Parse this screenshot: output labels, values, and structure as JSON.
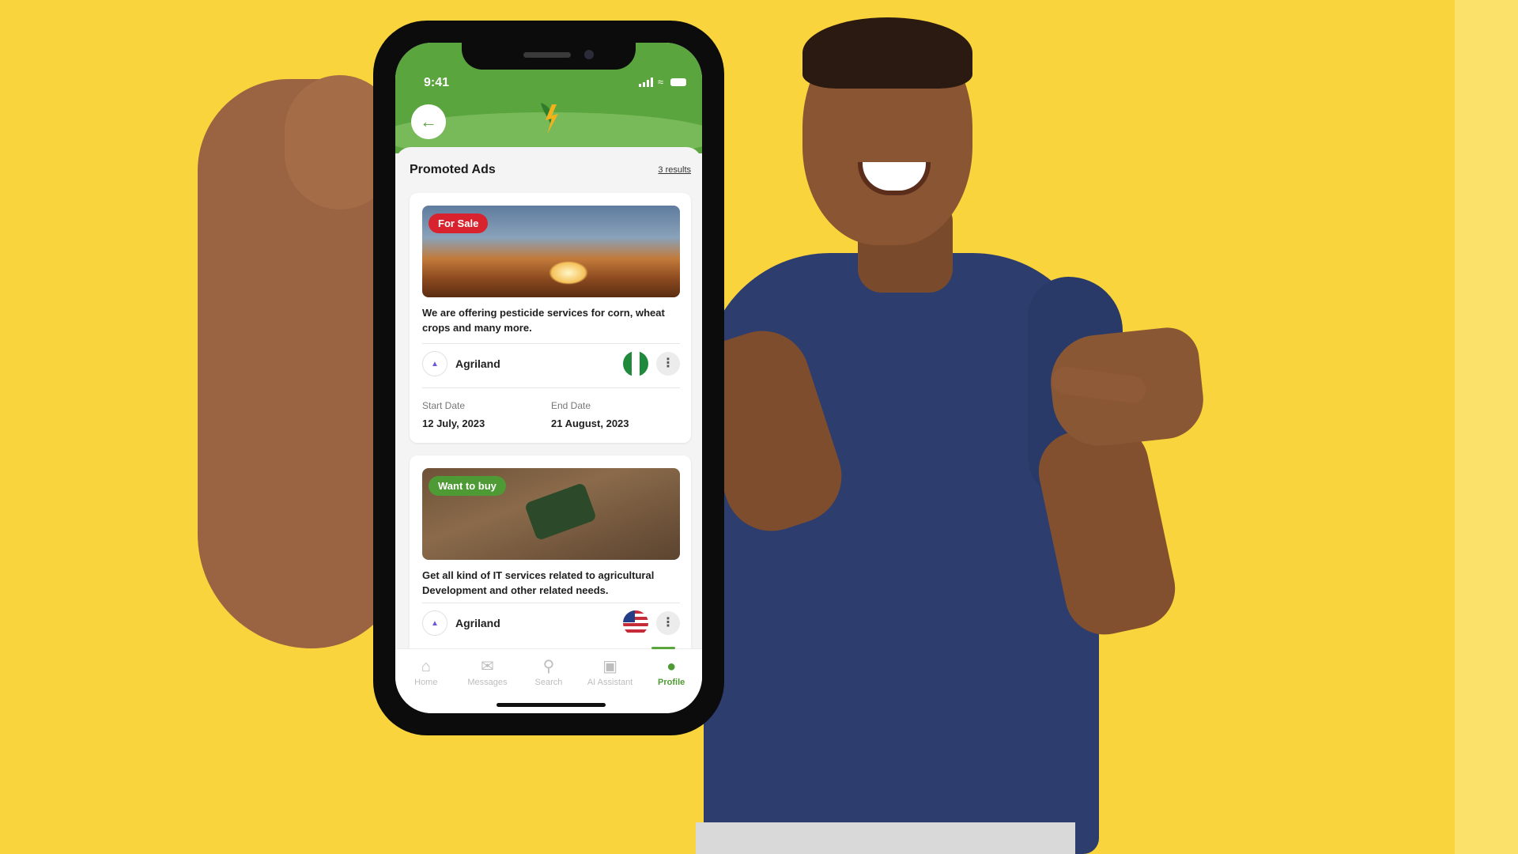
{
  "status_bar": {
    "time": "9:41"
  },
  "header": {
    "back_icon": "arrow-left-icon",
    "logo_icon": "app-leaf-logo"
  },
  "list": {
    "title": "Promoted Ads",
    "count": "3 results"
  },
  "ads": [
    {
      "badge": "For Sale",
      "badge_color": "#d8232f",
      "description": "We are offering pesticide services for corn, wheat crops and many more.",
      "seller": "Agriland",
      "flag": "nigeria-flag-icon",
      "start_label": "Start Date",
      "start_date": "12 July, 2023",
      "end_label": "End Date",
      "end_date": "21 August, 2023"
    },
    {
      "badge": "Want to buy",
      "badge_color": "#4e9a35",
      "description": "Get all kind of IT services related to agricultural Development and other related needs.",
      "seller": "Agriland",
      "flag": "usa-flag-icon"
    }
  ],
  "tabs": [
    {
      "label": "Home",
      "icon": "home-icon",
      "active": false
    },
    {
      "label": "Messages",
      "icon": "messages-icon",
      "active": false
    },
    {
      "label": "Search",
      "icon": "search-icon",
      "active": false
    },
    {
      "label": "AI Assistant",
      "icon": "robot-icon",
      "active": false
    },
    {
      "label": "Profile",
      "icon": "profile-icon",
      "active": true
    }
  ],
  "colors": {
    "brand_green": "#5aa53d",
    "background_yellow": "#f9d43d"
  }
}
